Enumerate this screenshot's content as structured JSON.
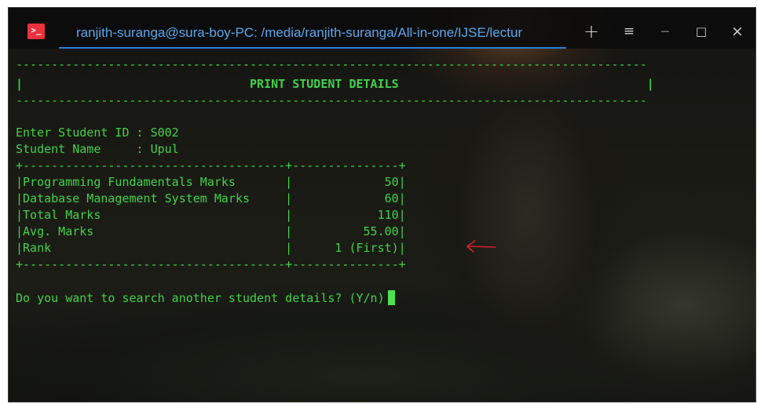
{
  "window": {
    "title": "ranjith-suranga@sura-boy-PC: /media/ranjith-suranga/All-in-one/IJSE/lectur",
    "app_icon": "terminal-icon",
    "buttons": {
      "new_tab": "+",
      "menu": "≡",
      "minimize": "—",
      "maximize": "□",
      "close": "×"
    }
  },
  "terminal": {
    "text_color": "#43d14a",
    "dash_line": "-----------------------------------------------------------------------------------------",
    "header_line": "|                                PRINT STUDENT DETAILS                                   |",
    "student_id_line": "Enter Student ID : S002",
    "student_name_line": "Student Name     : Upul",
    "table_border": "+-------------------------------------+---------------+",
    "table_rows": [
      "|Programming Fundamentals Marks       |             50|",
      "|Database Management System Marks     |             60|",
      "|Total Marks                          |            110|",
      "|Avg. Marks                           |          55.00|",
      "|Rank                                 |      1 (First)|"
    ],
    "prompt": "Do you want to search another student details? (Y/n)"
  },
  "annotation": {
    "arrow_color": "#d8202a",
    "arrow_icon": "red-arrow-icon"
  }
}
